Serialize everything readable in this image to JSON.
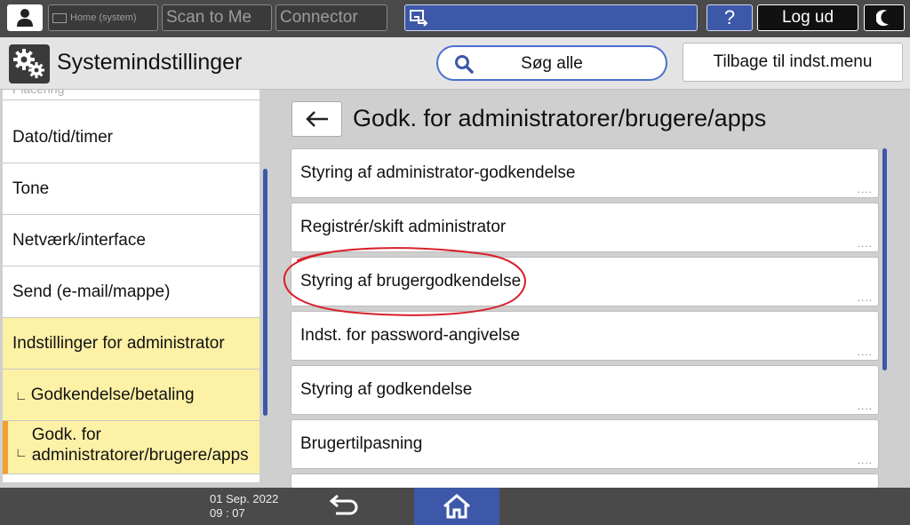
{
  "topbar": {
    "home_label": "Home (system)",
    "scan_label": "Scan to Me",
    "connector_label": "Connector",
    "help_label": "?",
    "logout_label": "Log ud"
  },
  "header": {
    "title": "Systemindstillinger",
    "search_label": "Søg alle",
    "back_menu_label": "Tilbage til indst.menu"
  },
  "sidebar": {
    "items": [
      {
        "label": "Placering"
      },
      {
        "label": "Dato/tid/timer"
      },
      {
        "label": "Tone"
      },
      {
        "label": "Netværk/interface"
      },
      {
        "label": "Send (e-mail/mappe)"
      },
      {
        "label": "Indstillinger for administrator"
      },
      {
        "label": "Godkendelse/betaling"
      },
      {
        "label": "Godk. for administratorer/brugere/apps"
      }
    ]
  },
  "main": {
    "title": "Godk. for administratorer/brugere/apps",
    "items": [
      {
        "label": "Styring af administrator-godkendelse"
      },
      {
        "label": "Registrér/skift administrator"
      },
      {
        "label": "Styring af brugergodkendelse"
      },
      {
        "label": "Indst. for password-angivelse"
      },
      {
        "label": "Styring af godkendelse"
      },
      {
        "label": "Brugertilpasning"
      }
    ],
    "more_indicator": "...."
  },
  "bottombar": {
    "date": "01 Sep. 2022",
    "time": "09 : 07"
  },
  "colors": {
    "accent_blue": "#3d58a8",
    "highlight_yellow": "#fdf1a6",
    "selection_orange": "#f0a030",
    "annotation_red": "#d8202a"
  }
}
